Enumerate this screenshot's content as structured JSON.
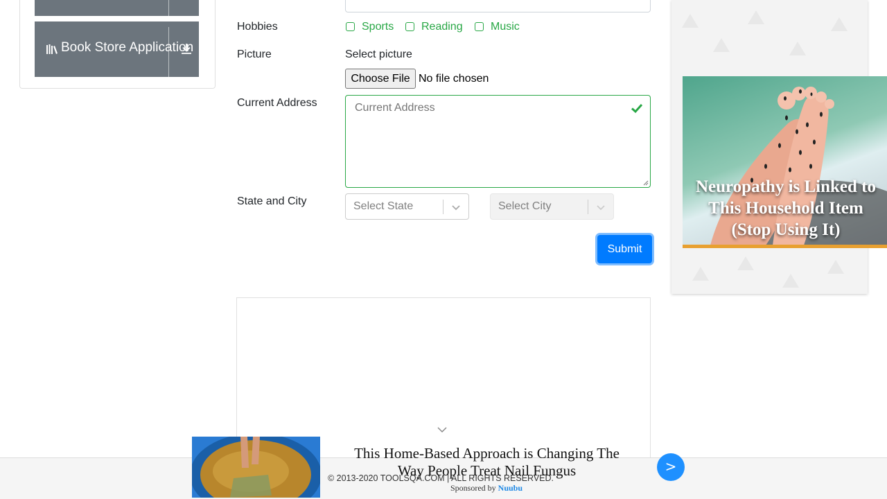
{
  "sidebar": {
    "items": [
      {
        "label": ""
      },
      {
        "label": "Book Store Application",
        "icon": "book-store-icon"
      }
    ]
  },
  "form": {
    "hobbies": {
      "label": "Hobbies",
      "options": [
        "Sports",
        "Reading",
        "Music"
      ]
    },
    "picture": {
      "label": "Picture",
      "select_text": "Select picture",
      "button": "Choose File",
      "status": "No file chosen"
    },
    "address": {
      "label": "Current Address",
      "placeholder": "Current Address"
    },
    "state_city": {
      "label": "State and City",
      "state_placeholder": "Select State",
      "city_placeholder": "Select City"
    },
    "submit": "Submit"
  },
  "right_ad": {
    "headline": "Neuropathy is Linked to This Household Item (Stop Using It)"
  },
  "bottom_ad": {
    "headline": "This Home-Based Approach is Changing The Way People Treat Nail Fungus",
    "sponsored_prefix": "Sponsored by",
    "sponsor": "Nuubu",
    "next": ">"
  },
  "footer": {
    "copyright": "© 2013-2020 TOOLSQA.COM | ALL RIGHTS RESERVED."
  },
  "colors": {
    "accent": "#007bff",
    "valid": "#28a745",
    "sidebar_item": "#6c757d"
  }
}
